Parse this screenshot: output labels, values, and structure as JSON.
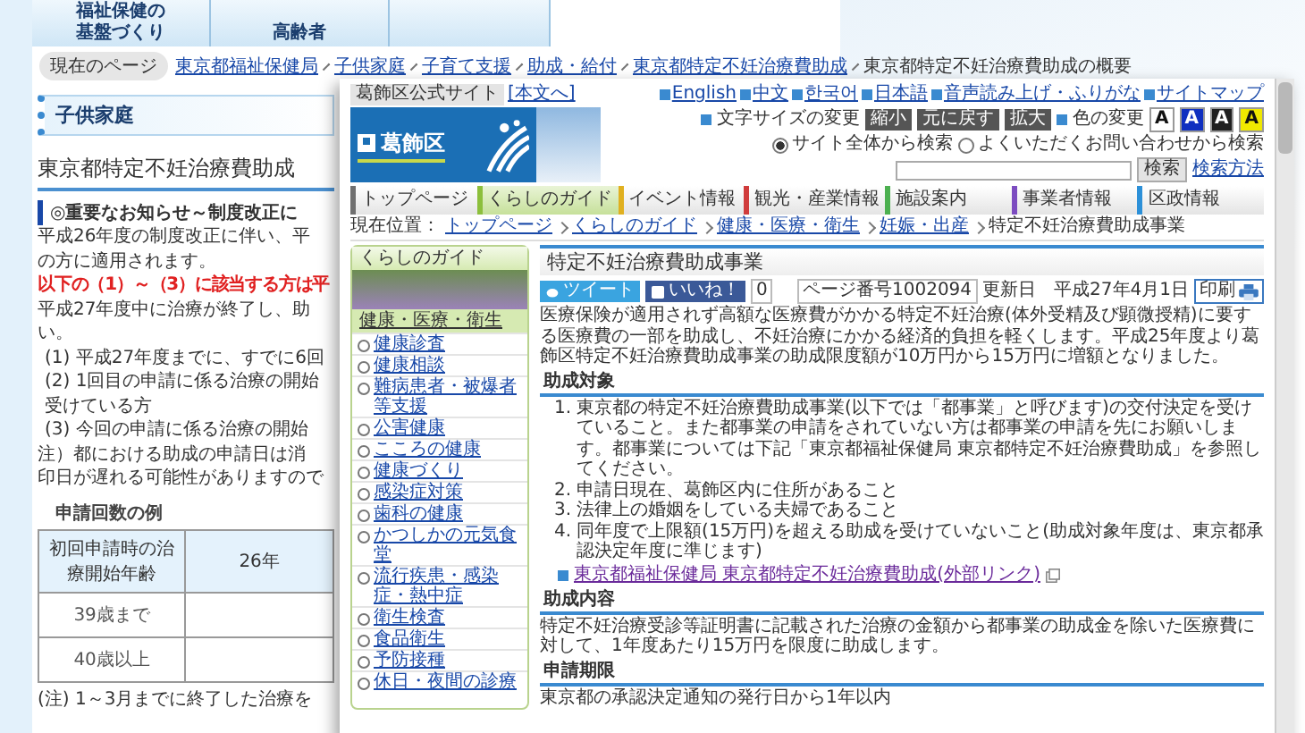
{
  "back_page": {
    "nav_tabs": [
      "福祉保健の基盤づくり",
      "高齢者"
    ],
    "breadcrumb": {
      "label": "現在のページ",
      "links": [
        "東京都福祉保健局",
        "子供家庭",
        "子育て支援",
        "助成・給付",
        "東京都特定不妊治療費助成"
      ],
      "current": "東京都特定不妊治療費助成の概要"
    },
    "sidebar_heading": "子供家庭",
    "title": "東京都特定不妊治療費助成",
    "notice": "◎重要なお知らせ～制度改正に",
    "lines": [
      {
        "kind": "normal",
        "text": "平成26年度の制度改正に伴い、平"
      },
      {
        "kind": "normal",
        "text": "の方に適用されます。"
      },
      {
        "kind": "alert",
        "text": "以下の（1）～（3）に該当する方は平"
      },
      {
        "kind": "normal",
        "text": "平成27年度中に治療が終了し、助"
      },
      {
        "kind": "normal",
        "text": "い。"
      },
      {
        "kind": "indent",
        "text": "(1) 平成27年度までに、すでに6回"
      },
      {
        "kind": "indent",
        "text": "(2) 1回目の申請に係る治療の開始"
      },
      {
        "kind": "indent",
        "text": "受けている方"
      },
      {
        "kind": "indent",
        "text": "(3) 今回の申請に係る治療の開始"
      },
      {
        "kind": "normal",
        "text": "注）都における助成の申請日は消"
      },
      {
        "kind": "normal",
        "text": "印日が遅れる可能性がありますので"
      }
    ],
    "table": {
      "caption": "申請回数の例",
      "columns": [
        "初回申請時の治療開始年齢",
        "26年"
      ],
      "rows": [
        "39歳まで",
        "40歳以上"
      ]
    },
    "footnote": "(注) 1～3月までに終了した治療を"
  },
  "front_page": {
    "site_label": "葛飾区公式サイト",
    "skip_link": "[本文へ]",
    "languages": [
      "English",
      "中文",
      "한국어",
      "日本語",
      "音声読み上げ・ふりがな",
      "サイトマップ"
    ],
    "text_size": {
      "label": "文字サイズの変更",
      "buttons": [
        "縮小",
        "元に戻す",
        "拡大"
      ]
    },
    "color_change": {
      "label": "色の変更",
      "options": [
        {
          "label": "A",
          "color": "#ffffff"
        },
        {
          "label": "A",
          "color": "#1030c0"
        },
        {
          "label": "A",
          "color": "#202020"
        },
        {
          "label": "A",
          "color": "#f0e800"
        }
      ]
    },
    "search": {
      "scopes": [
        {
          "label": "サイト全体から検索",
          "selected": true
        },
        {
          "label": "よくいただくお問い合わせから検索",
          "selected": false
        }
      ],
      "button": "検索",
      "help_link": "検索方法"
    },
    "logo": "葛飾区",
    "nav": [
      {
        "label": "トップページ",
        "selected": false,
        "color": "#707070"
      },
      {
        "label": "くらしのガイド",
        "selected": true,
        "color": "#8cbf3c"
      },
      {
        "label": "イベント情報",
        "selected": false,
        "color": "#e0b020"
      },
      {
        "label": "観光・産業情報",
        "selected": false,
        "color": "#d03c3c"
      },
      {
        "label": "施設案内",
        "selected": false,
        "color": "#4cb050"
      },
      {
        "label": "事業者情報",
        "selected": false,
        "color": "#7c4cc0"
      },
      {
        "label": "区政情報",
        "selected": false,
        "color": "#2c90d8"
      }
    ],
    "breadcrumb": {
      "label": "現在位置：",
      "links": [
        "トップページ",
        "くらしのガイド",
        "健康・医療・衛生",
        "妊娠・出産"
      ],
      "current": "特定不妊治療費助成事業"
    },
    "sidebar": {
      "title": "くらしのガイド",
      "section": "健康・医療・衛生",
      "items": [
        "健康診査",
        "健康相談",
        "難病患者・被爆者等支援",
        "公害健康",
        "こころの健康",
        "健康づくり",
        "感染症対策",
        "歯科の健康",
        "かつしかの元気食堂",
        "流行疾患・感染症・熱中症",
        "衛生検査",
        "食品衛生",
        "予防接種",
        "休日・夜間の診療"
      ]
    },
    "article": {
      "title": "特定不妊治療費助成事業",
      "tweet": "ツイート",
      "like": "いいね！",
      "like_count": "0",
      "page_number": "ページ番号1002094",
      "updated": "更新日　平成27年4月1日",
      "print": "印刷",
      "intro": "医療保険が適用されず高額な医療費がかかる特定不妊治療(体外受精及び顕微授精)に要する医療費の一部を助成し、不妊治療にかかる経済的負担を軽くします。平成25年度より葛飾区特定不妊治療費助成事業の助成限度額が10万円から15万円に増額となりました。",
      "sections": [
        {
          "kind": "list",
          "heading": "助成対象",
          "items": [
            {
              "number": "1.",
              "text": "東京都の特定不妊治療費助成事業(以下では「都事業」と呼びます)の交付決定を受けていること。また都事業の申請をされていない方は都事業の申請を先にお願いします。都事業については下記「東京都福祉保健局 東京都特定不妊治療費助成」を参照してください。"
            },
            {
              "number": "2.",
              "text": "申請日現在、葛飾区内に住所があること"
            },
            {
              "number": "3.",
              "text": "法律上の婚姻をしている夫婦であること"
            },
            {
              "number": "4.",
              "text": "同年度で上限額(15万円)を超える助成を受けていないこと(助成対象年度は、東京都承認決定年度に準じます)"
            }
          ],
          "link": "東京都福祉保健局 東京都特定不妊治療費助成(外部リンク)"
        },
        {
          "kind": "text",
          "heading": "助成内容",
          "text": "特定不妊治療受診等証明書に記載された治療の金額から都事業の助成金を除いた医療費に対して、1年度あたり15万円を限度に助成します。"
        },
        {
          "kind": "text",
          "heading": "申請期限",
          "text": "東京都の承認決定通知の発行日から1年以内"
        }
      ]
    }
  }
}
